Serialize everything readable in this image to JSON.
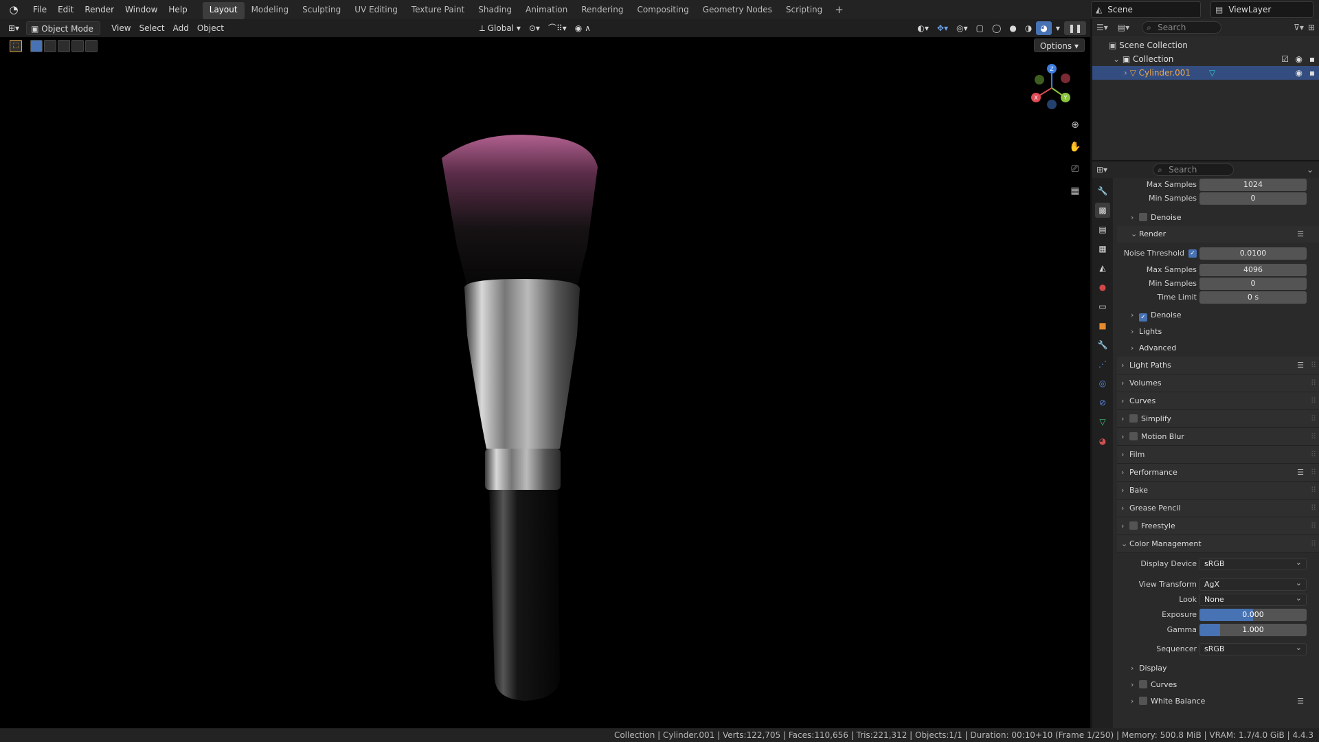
{
  "topbar": {
    "menus": [
      "File",
      "Edit",
      "Render",
      "Window",
      "Help"
    ],
    "workspaces": [
      "Layout",
      "Modeling",
      "Sculpting",
      "UV Editing",
      "Texture Paint",
      "Shading",
      "Animation",
      "Rendering",
      "Compositing",
      "Geometry Nodes",
      "Scripting"
    ],
    "active_workspace": "Layout",
    "scene": "Scene",
    "view_layer": "ViewLayer"
  },
  "viewport": {
    "mode": "Object Mode",
    "menus": [
      "View",
      "Select",
      "Add",
      "Object"
    ],
    "transform_orientation": "Global",
    "options_label": "Options"
  },
  "outliner": {
    "search_placeholder": "Search",
    "scene_collection": "Scene Collection",
    "collection": "Collection",
    "object": "Cylinder.001"
  },
  "properties": {
    "search_placeholder": "Search",
    "viewport": {
      "max_samples_label": "Max Samples",
      "max_samples": "1024",
      "min_samples_label": "Min Samples",
      "min_samples": "0",
      "denoise_label": "Denoise"
    },
    "render_label": "Render",
    "render": {
      "noise_threshold_label": "Noise Threshold",
      "noise_threshold": "0.0100",
      "max_samples_label": "Max Samples",
      "max_samples": "4096",
      "min_samples_label": "Min Samples",
      "min_samples": "0",
      "time_limit_label": "Time Limit",
      "time_limit": "0 s",
      "denoise_label": "Denoise",
      "lights_label": "Lights",
      "advanced_label": "Advanced"
    },
    "sections": {
      "light_paths": "Light Paths",
      "volumes": "Volumes",
      "curves": "Curves",
      "simplify": "Simplify",
      "motion_blur": "Motion Blur",
      "film": "Film",
      "performance": "Performance",
      "bake": "Bake",
      "grease_pencil": "Grease Pencil",
      "freestyle": "Freestyle",
      "color_management": "Color Management"
    },
    "color_management": {
      "display_device_label": "Display Device",
      "display_device": "sRGB",
      "view_transform_label": "View Transform",
      "view_transform": "AgX",
      "look_label": "Look",
      "look": "None",
      "exposure_label": "Exposure",
      "exposure": "0.000",
      "exposure_fill": 0.5,
      "gamma_label": "Gamma",
      "gamma": "1.000",
      "gamma_fill": 0.19,
      "sequencer_label": "Sequencer",
      "sequencer": "sRGB",
      "display_label": "Display",
      "curves_label": "Curves",
      "white_balance_label": "White Balance"
    }
  },
  "statusbar": {
    "text": "Collection | Cylinder.001 | Verts:122,705 | Faces:110,656 | Tris:221,312 | Objects:1/1 | Duration: 00:10+10 (Frame 1/250) | Memory: 500.8 MiB | VRAM: 1.7/4.0 GiB | 4.4.3"
  },
  "colors": {
    "accent": "#4772b3",
    "selection_row": "#334d80",
    "object_orange": "#e6a243"
  }
}
